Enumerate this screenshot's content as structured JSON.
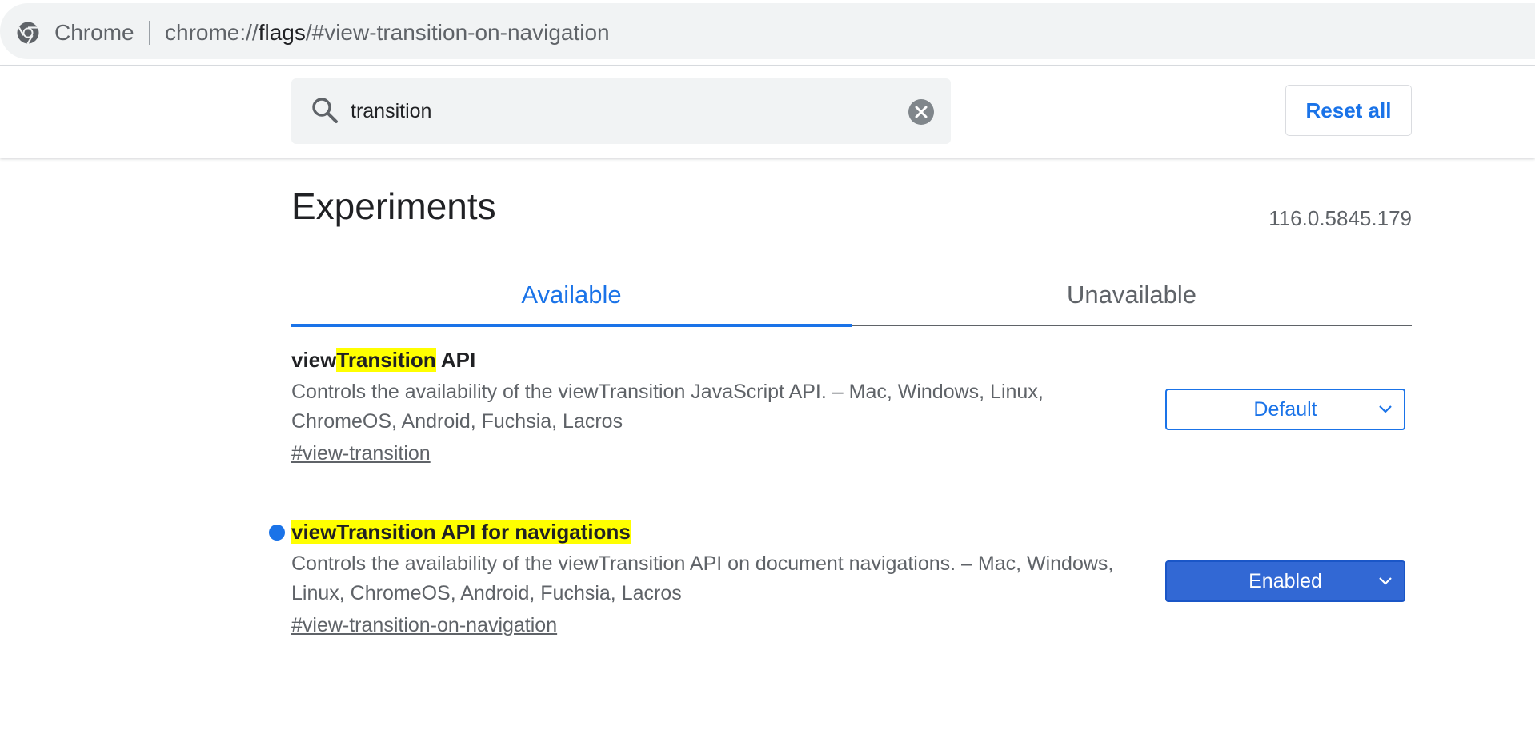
{
  "omnibox": {
    "origin_label": "Chrome",
    "url_prefix": "chrome://",
    "url_host": "flags",
    "url_rest": "/#view-transition-on-navigation"
  },
  "search": {
    "value": "transition",
    "placeholder": "",
    "reset_label": "Reset all"
  },
  "page": {
    "title": "Experiments",
    "version": "116.0.5845.179"
  },
  "tabs": [
    {
      "label": "Available",
      "active": true
    },
    {
      "label": "Unavailable",
      "active": false
    }
  ],
  "experiments": [
    {
      "title_before": "view",
      "title_highlight": "Transition",
      "title_after": " API",
      "description": "Controls the availability of the viewTransition JavaScript API. – Mac, Windows, Linux, ChromeOS, Android, Fuchsia, Lacros",
      "link": "#view-transition",
      "state": "Default",
      "modified": false
    },
    {
      "title_before": "",
      "title_highlight": "viewTransition API for navigations",
      "title_after": "",
      "description": "Controls the availability of the viewTransition API on document navigations. – Mac, Windows, Linux, ChromeOS, Android, Fuchsia, Lacros",
      "link": "#view-transition-on-navigation",
      "state": "Enabled",
      "modified": true
    }
  ],
  "colors": {
    "accent": "#1a73e8",
    "highlight": "#ffff00",
    "enabled_select": "#3268d4"
  },
  "icons": {
    "omnibox": "chrome-logo-icon",
    "search": "search-icon",
    "clear": "clear-circle-icon",
    "dropdown": "chevron-down-icon",
    "modified": "modified-dot-icon"
  }
}
